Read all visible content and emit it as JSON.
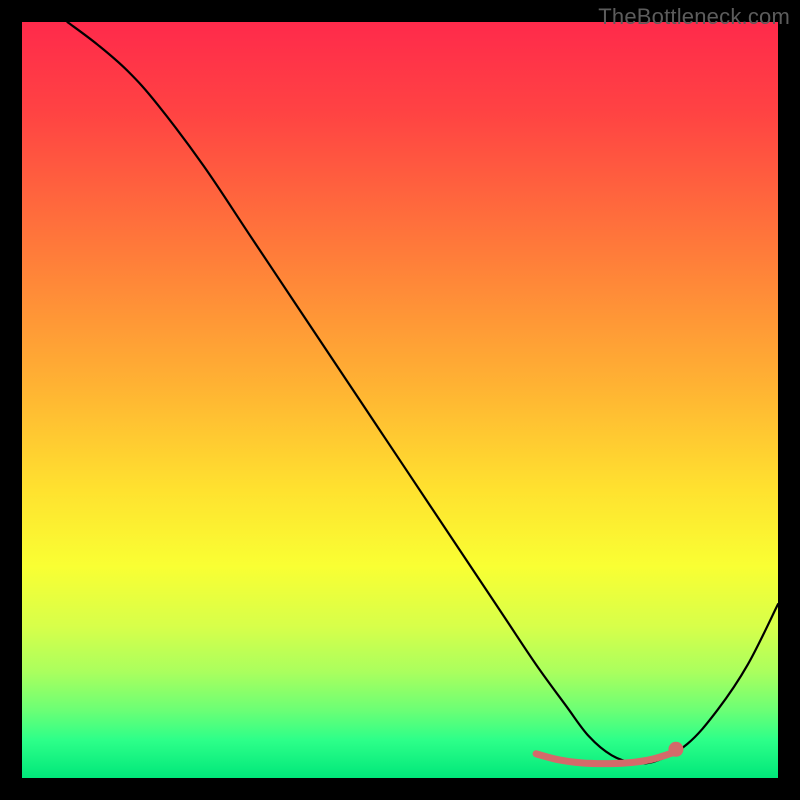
{
  "watermark": "TheBottleneck.com",
  "chart_data": {
    "type": "line",
    "title": "",
    "xlabel": "",
    "ylabel": "",
    "xlim": [
      0,
      100
    ],
    "ylim": [
      0,
      100
    ],
    "grid": false,
    "legend": false,
    "background": {
      "type": "vertical-gradient",
      "stops": [
        {
          "offset": 0.0,
          "color": "#ff2a4b"
        },
        {
          "offset": 0.12,
          "color": "#ff4343"
        },
        {
          "offset": 0.3,
          "color": "#ff7a3a"
        },
        {
          "offset": 0.48,
          "color": "#ffb233"
        },
        {
          "offset": 0.62,
          "color": "#ffe22f"
        },
        {
          "offset": 0.72,
          "color": "#f9ff33"
        },
        {
          "offset": 0.8,
          "color": "#d7ff4a"
        },
        {
          "offset": 0.86,
          "color": "#aaff5e"
        },
        {
          "offset": 0.91,
          "color": "#6cff75"
        },
        {
          "offset": 0.95,
          "color": "#2dff89"
        },
        {
          "offset": 1.0,
          "color": "#00e77a"
        }
      ]
    },
    "series": [
      {
        "name": "bottleneck-curve",
        "stroke": "#000000",
        "stroke_width": 2.2,
        "x": [
          6,
          10,
          14,
          18,
          24,
          30,
          36,
          42,
          48,
          54,
          60,
          64,
          68,
          72,
          75,
          78,
          81,
          84,
          88,
          92,
          96,
          100
        ],
        "y": [
          100,
          97,
          93.5,
          89,
          81,
          72,
          63,
          54,
          45,
          36,
          27,
          21,
          15,
          9.5,
          5.5,
          3,
          2,
          2.3,
          4.5,
          9,
          15,
          23
        ]
      }
    ],
    "highlight": {
      "name": "optimal-range",
      "stroke": "#d46a6a",
      "stroke_width": 7,
      "linecap": "round",
      "x": [
        68,
        71,
        74,
        77,
        80,
        83,
        86
      ],
      "y": [
        3.2,
        2.4,
        2.0,
        1.9,
        2.0,
        2.4,
        3.3
      ]
    },
    "marker": {
      "name": "selected-point",
      "fill": "#d46a6a",
      "radius": 7.5,
      "x": 86.5,
      "y": 3.8
    }
  }
}
